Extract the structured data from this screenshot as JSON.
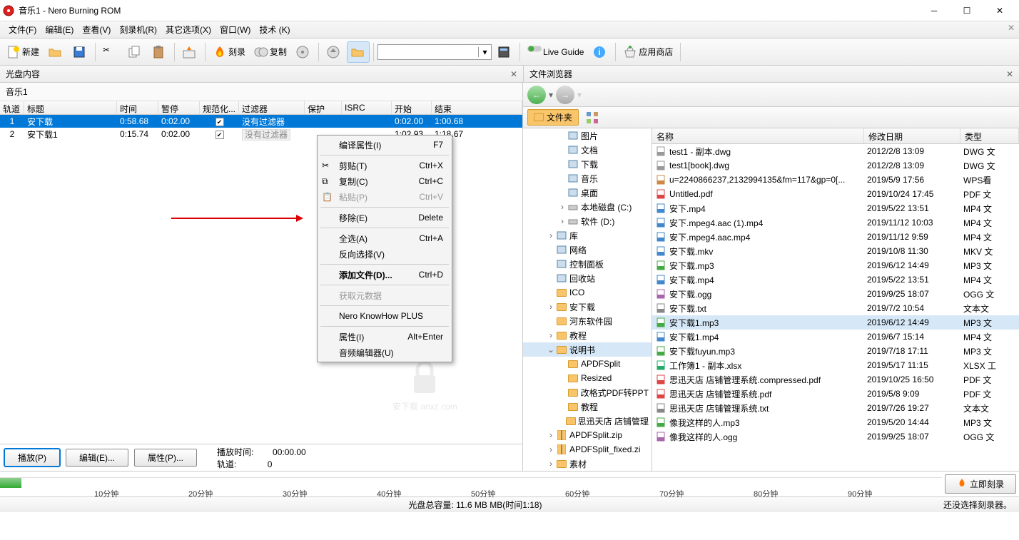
{
  "window": {
    "title": "音乐1 - Nero Burning ROM"
  },
  "menu": {
    "file": "文件(F)",
    "edit": "编辑(E)",
    "view": "查看(V)",
    "recorder": "刻录机(R)",
    "extras": "其它选项(X)",
    "window": "窗口(W)",
    "tech": "技术 (K)"
  },
  "toolbar": {
    "new": "新建",
    "burn": "刻录",
    "copy": "复制",
    "liveguide": "Live Guide",
    "appstore": "应用商店"
  },
  "panels": {
    "left": "光盘内容",
    "right": "文件浏览器"
  },
  "doc": {
    "name": "音乐1"
  },
  "trackHeaders": {
    "track": "轨道",
    "title": "标题",
    "time": "时间",
    "pause": "暂停",
    "norm": "规范化...",
    "filter": "过滤器",
    "protect": "保护",
    "isrc": "ISRC",
    "start": "开始",
    "end": "结束"
  },
  "tracks": [
    {
      "n": "1",
      "title": "安下载",
      "time": "0:58.68",
      "pause": "0:02.00",
      "norm": true,
      "filter": "没有过滤器",
      "start": "0:02.00",
      "end": "1:00.68",
      "sel": true
    },
    {
      "n": "2",
      "title": "安下载1",
      "time": "0:15.74",
      "pause": "0:02.00",
      "norm": true,
      "filter": "没有过滤器",
      "start": "1:02.93",
      "end": "1:18.67",
      "sel": false
    }
  ],
  "context": {
    "compileProps": "编译属性(I)",
    "cut": "剪贴(T)",
    "copy": "复制(C)",
    "paste": "粘贴(P)",
    "remove": "移除(E)",
    "selectAll": "全选(A)",
    "invertSel": "反向选择(V)",
    "addFiles": "添加文件(D)...",
    "getMeta": "获取元数据",
    "knowhow": "Nero KnowHow PLUS",
    "props": "属性(I)",
    "audioEditor": "音频编辑器(U)",
    "sc_f7": "F7",
    "sc_cut": "Ctrl+X",
    "sc_copy": "Ctrl+C",
    "sc_paste": "Ctrl+V",
    "sc_del": "Delete",
    "sc_all": "Ctrl+A",
    "sc_add": "Ctrl+D",
    "sc_props": "Alt+Enter"
  },
  "buttons": {
    "play": "播放(P)",
    "edit": "编辑(E)...",
    "props": "属性(P)..."
  },
  "playback": {
    "timeLbl": "播放时间:",
    "timeVal": "00:00.00",
    "trackLbl": "轨道:",
    "trackVal": "0"
  },
  "folderChip": "文件夹",
  "tree": [
    {
      "d": 3,
      "exp": "",
      "ic": "pic",
      "label": "图片"
    },
    {
      "d": 3,
      "exp": "",
      "ic": "doc",
      "label": "文档"
    },
    {
      "d": 3,
      "exp": "",
      "ic": "dl",
      "label": "下载"
    },
    {
      "d": 3,
      "exp": "",
      "ic": "music",
      "label": "音乐"
    },
    {
      "d": 3,
      "exp": "",
      "ic": "desk",
      "label": "桌面"
    },
    {
      "d": 3,
      "exp": ">",
      "ic": "drive",
      "label": "本地磁盘 (C:)"
    },
    {
      "d": 3,
      "exp": ">",
      "ic": "drive",
      "label": "软件 (D:)"
    },
    {
      "d": 2,
      "exp": ">",
      "ic": "lib",
      "label": "库"
    },
    {
      "d": 2,
      "exp": "",
      "ic": "net",
      "label": "网络"
    },
    {
      "d": 2,
      "exp": "",
      "ic": "cp",
      "label": "控制面板"
    },
    {
      "d": 2,
      "exp": "",
      "ic": "bin",
      "label": "回收站"
    },
    {
      "d": 2,
      "exp": "",
      "ic": "folder",
      "label": "ICO"
    },
    {
      "d": 2,
      "exp": ">",
      "ic": "folder",
      "label": "安下载"
    },
    {
      "d": 2,
      "exp": "",
      "ic": "folder",
      "label": "河东软件园"
    },
    {
      "d": 2,
      "exp": ">",
      "ic": "folder",
      "label": "教程"
    },
    {
      "d": 2,
      "exp": "v",
      "ic": "folder",
      "label": "说明书",
      "sel": true
    },
    {
      "d": 3,
      "exp": "",
      "ic": "folder",
      "label": "APDFSplit"
    },
    {
      "d": 3,
      "exp": "",
      "ic": "folder",
      "label": "Resized"
    },
    {
      "d": 3,
      "exp": "",
      "ic": "folder",
      "label": "改格式PDF转PPT"
    },
    {
      "d": 3,
      "exp": "",
      "ic": "folder",
      "label": "教程"
    },
    {
      "d": 3,
      "exp": "",
      "ic": "folder",
      "label": "思迅天店 店铺管理"
    },
    {
      "d": 2,
      "exp": ">",
      "ic": "zip",
      "label": "APDFSplit.zip"
    },
    {
      "d": 2,
      "exp": ">",
      "ic": "zip",
      "label": "APDFSplit_fixed.zi"
    },
    {
      "d": 2,
      "exp": ">",
      "ic": "folder",
      "label": "素材"
    }
  ],
  "fileHeaders": {
    "name": "名称",
    "date": "修改日期",
    "type": "类型"
  },
  "files": [
    {
      "ic": "dwg",
      "name": "test1 - 副本.dwg",
      "date": "2012/2/8 13:09",
      "type": "DWG 文"
    },
    {
      "ic": "dwg",
      "name": "test1[book].dwg",
      "date": "2012/2/8 13:09",
      "type": "DWG 文"
    },
    {
      "ic": "gif",
      "name": "u=2240866237,2132994135&fm=117&gp=0[...",
      "date": "2019/5/9 17:56",
      "type": "WPS看"
    },
    {
      "ic": "pdf",
      "name": "Untitled.pdf",
      "date": "2019/10/24 17:45",
      "type": "PDF 文"
    },
    {
      "ic": "mp4",
      "name": "安下.mp4",
      "date": "2019/5/22 13:51",
      "type": "MP4 文"
    },
    {
      "ic": "mp4",
      "name": "安下.mpeg4.aac (1).mp4",
      "date": "2019/11/12 10:03",
      "type": "MP4 文"
    },
    {
      "ic": "mp4",
      "name": "安下.mpeg4.aac.mp4",
      "date": "2019/11/12 9:59",
      "type": "MP4 文"
    },
    {
      "ic": "mkv",
      "name": "安下载.mkv",
      "date": "2019/10/8 11:30",
      "type": "MKV 文"
    },
    {
      "ic": "mp3",
      "name": "安下载.mp3",
      "date": "2019/6/12 14:49",
      "type": "MP3 文"
    },
    {
      "ic": "mp4",
      "name": "安下载.mp4",
      "date": "2019/5/22 13:51",
      "type": "MP4 文"
    },
    {
      "ic": "ogg",
      "name": "安下载.ogg",
      "date": "2019/9/25 18:07",
      "type": "OGG 文"
    },
    {
      "ic": "txt",
      "name": "安下载.txt",
      "date": "2019/7/2 10:54",
      "type": "文本文"
    },
    {
      "ic": "mp3",
      "name": "安下载1.mp3",
      "date": "2019/6/12 14:49",
      "type": "MP3 文",
      "sel": true
    },
    {
      "ic": "mp4",
      "name": "安下载1.mp4",
      "date": "2019/6/7 15:14",
      "type": "MP4 文"
    },
    {
      "ic": "mp3",
      "name": "安下载fuyun.mp3",
      "date": "2019/7/18 17:11",
      "type": "MP3 文"
    },
    {
      "ic": "xlsx",
      "name": "工作簿1 - 副本.xlsx",
      "date": "2019/5/17 11:15",
      "type": "XLSX 工"
    },
    {
      "ic": "pdf",
      "name": "思迅天店 店铺管理系统.compressed.pdf",
      "date": "2019/10/25 16:50",
      "type": "PDF 文"
    },
    {
      "ic": "pdf",
      "name": "思迅天店 店铺管理系统.pdf",
      "date": "2019/5/8 9:09",
      "type": "PDF 文"
    },
    {
      "ic": "txt",
      "name": "思迅天店 店铺管理系统.txt",
      "date": "2019/7/26 19:27",
      "type": "文本文"
    },
    {
      "ic": "mp3",
      "name": "像我这样的人.mp3",
      "date": "2019/5/20 14:44",
      "type": "MP3 文"
    },
    {
      "ic": "ogg",
      "name": "像我这样的人.ogg",
      "date": "2019/9/25 18:07",
      "type": "OGG 文"
    }
  ],
  "timeline": {
    "ticks": [
      "10分钟",
      "20分钟",
      "30分钟",
      "40分钟",
      "50分钟",
      "60分钟",
      "70分钟",
      "80分钟",
      "90分钟"
    ],
    "burnNow": "立即刻录"
  },
  "status": {
    "capacity": "光盘总容量:   11.6 MB MB(时间1:18)",
    "recorder": "还没选择刻录器。"
  },
  "watermark": "安下载 anxz.com"
}
